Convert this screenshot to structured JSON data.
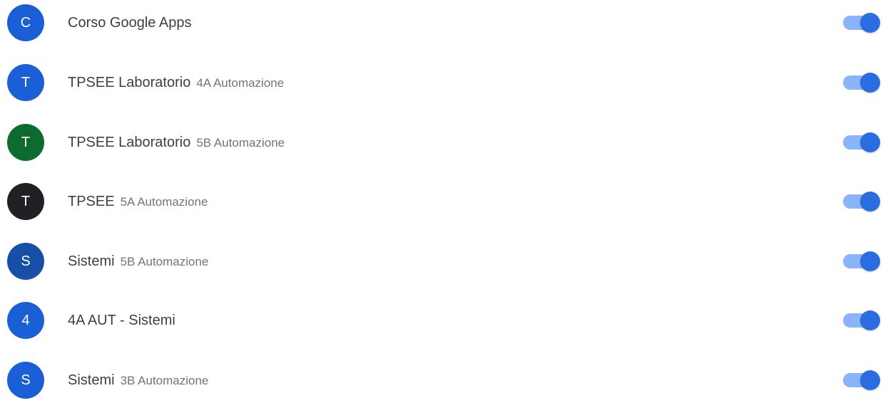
{
  "colors": {
    "toggle_track": "#8ab4f8",
    "toggle_thumb": "#2a6de0"
  },
  "classes": [
    {
      "initial": "C",
      "name": "Corso Google Apps",
      "subtitle": "",
      "avatar_color": "#1a5fd6",
      "toggle_on": true
    },
    {
      "initial": "T",
      "name": "TPSEE Laboratorio",
      "subtitle": "4A Automazione",
      "avatar_color": "#1a5fd6",
      "toggle_on": true
    },
    {
      "initial": "T",
      "name": "TPSEE Laboratorio",
      "subtitle": "5B Automazione",
      "avatar_color": "#0d6b2f",
      "toggle_on": true
    },
    {
      "initial": "T",
      "name": "TPSEE",
      "subtitle": "5A Automazione",
      "avatar_color": "#202124",
      "toggle_on": true
    },
    {
      "initial": "S",
      "name": "Sistemi",
      "subtitle": "5B Automazione",
      "avatar_color": "#174ea6",
      "toggle_on": true
    },
    {
      "initial": "4",
      "name": "4A AUT - Sistemi",
      "subtitle": "",
      "avatar_color": "#1a5fd6",
      "toggle_on": true
    },
    {
      "initial": "S",
      "name": "Sistemi",
      "subtitle": "3B Automazione",
      "avatar_color": "#1a5fd6",
      "toggle_on": true
    }
  ]
}
